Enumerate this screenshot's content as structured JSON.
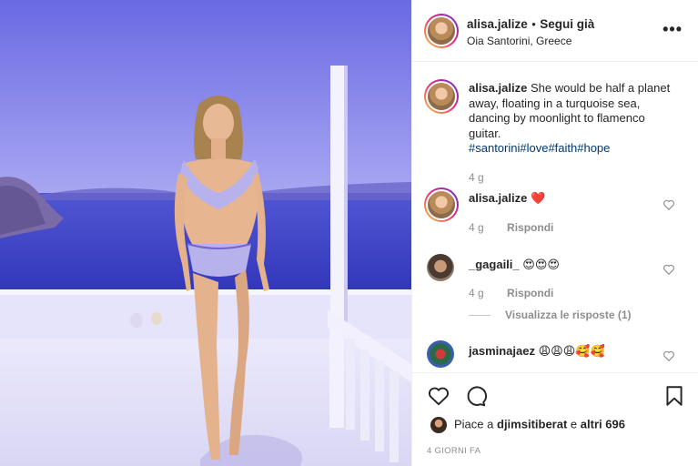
{
  "post": {
    "username": "alisa.jalize",
    "separator": "•",
    "follow_label": "Segui già",
    "location": "Oia Santorini, Greece",
    "more_icon": "more-icon"
  },
  "caption": {
    "username": "alisa.jalize",
    "text": "She would be half a planet away, floating in a turquoise sea, dancing by moonlight to flamenco guitar.",
    "hashtags": "#santorini#love#faith#hope",
    "time": "4 g"
  },
  "comments": [
    {
      "username": "alisa.jalize",
      "text": "❤️",
      "time": "4 g",
      "reply_label": "Rispondi"
    },
    {
      "username": "_gagaili_",
      "text": "😍😍😍",
      "time": "4 g",
      "reply_label": "Rispondi",
      "view_replies": "Visualizza le risposte (1)"
    },
    {
      "username": "jasminajaez",
      "text": "😩😩😩🥰🥰"
    }
  ],
  "likes": {
    "prefix": "Piace a",
    "user": "djimsitiberat",
    "suffix": "e",
    "others": "altri 696"
  },
  "timestamp": "4 GIORNI FA",
  "colors": {
    "link": "#00376b",
    "secondary_text": "#8e8e8e",
    "heart_red": "#ed4956"
  }
}
